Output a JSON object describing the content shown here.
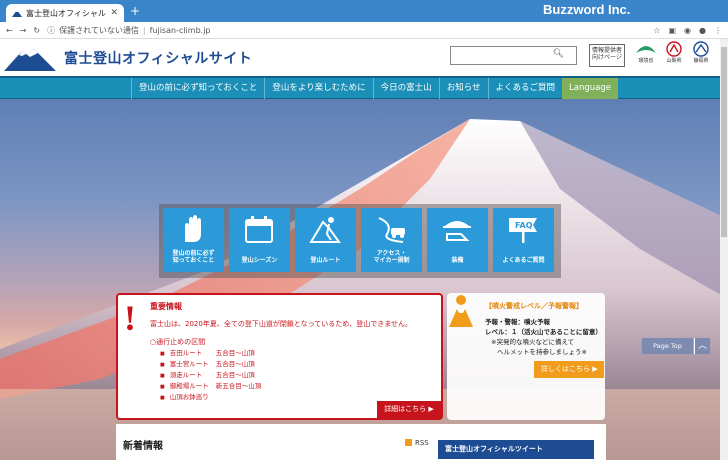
{
  "browser": {
    "tab_title": "富士登山オフィシャルサイト",
    "security_text": "保護されていない通信",
    "url": "fujisan-climb.jp",
    "watermark": "Buzzword Inc."
  },
  "header": {
    "site_title": "富士登山オフィシャルサイト",
    "search_placeholder": "",
    "info_box_text": "情報提供者向けページ",
    "orgs": [
      "環境省",
      "山梨県",
      "静岡県"
    ]
  },
  "nav": {
    "items": [
      "登山の前に必ず知っておくこと",
      "登山をより楽しむために",
      "今日の富士山",
      "お知らせ",
      "よくあるご質問"
    ],
    "language": "Language"
  },
  "tiles": [
    {
      "label_1": "登山の前に必ず",
      "label_2": "知っておくこと",
      "icon": "hand-icon"
    },
    {
      "label_1": "登山シーズン",
      "label_2": "",
      "icon": "calendar-icon"
    },
    {
      "label_1": "登山ルート",
      "label_2": "",
      "icon": "route-icon"
    },
    {
      "label_1": "アクセス・",
      "label_2": "マイカー規制",
      "icon": "car-icon"
    },
    {
      "label_1": "装備",
      "label_2": "",
      "icon": "equipment-icon"
    },
    {
      "label_1": "よくあるご質問",
      "label_2": "",
      "icon": "faq-icon"
    }
  ],
  "alert": {
    "title": "重要情報",
    "message": "富士山は、2020年夏、全ての登下山道が閉鎖となっているため、登山できません。",
    "closed_heading": "○通行止めの区間",
    "routes": [
      {
        "name": "吉田ルート",
        "segment": "五合目〜山頂"
      },
      {
        "name": "富士宮ルート",
        "segment": "五合目〜山頂"
      },
      {
        "name": "須走ルート",
        "segment": "五合目〜山頂"
      },
      {
        "name": "御殿場ルート",
        "segment": "新五合目〜山頂"
      },
      {
        "name": "山頂お鉢巡り",
        "segment": ""
      }
    ],
    "details_button": "詳細はこちら ▶"
  },
  "volcano": {
    "title": "【噴火警戒レベル／予報警報】",
    "line1": "予報・警報：噴火予報",
    "line2": "レベル：１（活火山であることに留意）",
    "note1": "※突発的な噴火などに備えて",
    "note2": "ヘルメットを持参しましょう※",
    "button": "詳しくはこちら ▶"
  },
  "news": {
    "title": "新着情報",
    "rss": "RSS",
    "tweet_heading": "富士登山オフィシャルツイート"
  },
  "pagetop": {
    "label": "Page Top",
    "arrow": "︿"
  }
}
